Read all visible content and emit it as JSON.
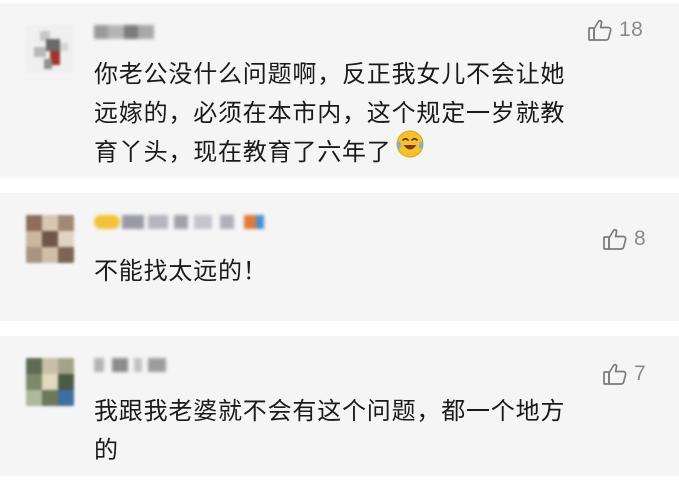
{
  "comments": [
    {
      "likes": "18",
      "text_lines": [
        "你老公没什么问题啊，反正我女儿不会让她",
        "远嫁的，必须在本市内，这个规定一岁就教",
        "育丫头，现在教育了六年了"
      ],
      "emoji": "crying-laughing-emoji"
    },
    {
      "likes": "8",
      "text_lines": [
        "不能找太远的！"
      ]
    },
    {
      "likes": "7",
      "text_lines": [
        "我跟我老婆就不会有这个问题，都一个地方",
        "的"
      ]
    }
  ],
  "colors": {
    "card_bg": "#f5f5f5",
    "text": "#1a1a1a",
    "like_gray": "#8a8a8a"
  },
  "icons": [
    "thumbs-up-icon",
    "crying-laughing-emoji"
  ]
}
